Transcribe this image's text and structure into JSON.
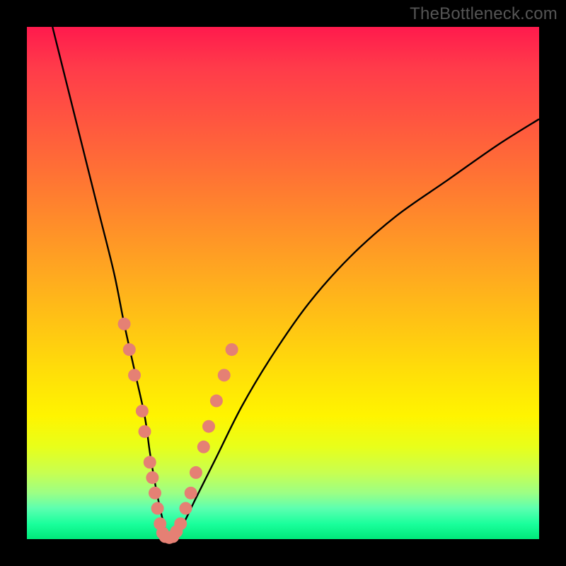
{
  "watermark": "TheBottleneck.com",
  "colors": {
    "frame": "#000000",
    "gradient_top": "#ff1a4d",
    "gradient_bottom": "#00e97a",
    "curve": "#000000",
    "dot_fill": "#e58074",
    "dot_stroke": "#c96a5f"
  },
  "chart_data": {
    "type": "line",
    "title": "",
    "xlabel": "",
    "ylabel": "",
    "xlim": [
      0,
      100
    ],
    "ylim": [
      0,
      100
    ],
    "series": [
      {
        "name": "bottleneck-curve",
        "x": [
          5,
          8,
          11,
          14,
          17,
          19,
          21,
          23,
          24,
          25,
          26,
          27,
          28,
          30,
          33,
          37,
          42,
          48,
          55,
          63,
          72,
          82,
          92,
          100
        ],
        "y": [
          100,
          88,
          76,
          64,
          52,
          42,
          33,
          24,
          17,
          11,
          6,
          2,
          0,
          2,
          8,
          16,
          26,
          36,
          46,
          55,
          63,
          70,
          77,
          82
        ]
      }
    ],
    "scatter_points": {
      "name": "highlighted-dots",
      "points": [
        {
          "x": 19.0,
          "y": 42
        },
        {
          "x": 20.0,
          "y": 37
        },
        {
          "x": 21.0,
          "y": 32
        },
        {
          "x": 22.5,
          "y": 25
        },
        {
          "x": 23.0,
          "y": 21
        },
        {
          "x": 24.0,
          "y": 15
        },
        {
          "x": 24.5,
          "y": 12
        },
        {
          "x": 25.0,
          "y": 9
        },
        {
          "x": 25.5,
          "y": 6
        },
        {
          "x": 26.0,
          "y": 3
        },
        {
          "x": 26.5,
          "y": 1.2
        },
        {
          "x": 27.0,
          "y": 0.5
        },
        {
          "x": 27.8,
          "y": 0.3
        },
        {
          "x": 28.5,
          "y": 0.5
        },
        {
          "x": 29.2,
          "y": 1.5
        },
        {
          "x": 30.0,
          "y": 3
        },
        {
          "x": 31.0,
          "y": 6
        },
        {
          "x": 32.0,
          "y": 9
        },
        {
          "x": 33.0,
          "y": 13
        },
        {
          "x": 34.5,
          "y": 18
        },
        {
          "x": 35.5,
          "y": 22
        },
        {
          "x": 37.0,
          "y": 27
        },
        {
          "x": 38.5,
          "y": 32
        },
        {
          "x": 40.0,
          "y": 37
        }
      ]
    }
  }
}
